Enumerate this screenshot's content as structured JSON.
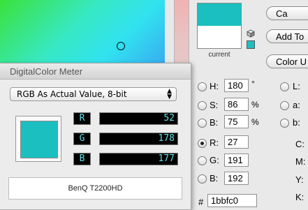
{
  "color_picker": {
    "preview_label": "current",
    "buttons": [
      "Ca",
      "Add To",
      "Color U"
    ],
    "hsb": [
      {
        "label": "H:",
        "value": "180",
        "unit": "°"
      },
      {
        "label": "S:",
        "value": "86",
        "unit": "%"
      },
      {
        "label": "B:",
        "value": "75",
        "unit": "%"
      }
    ],
    "rgb": [
      {
        "label": "R:",
        "value": "27",
        "selected": true
      },
      {
        "label": "G:",
        "value": "191",
        "selected": false
      },
      {
        "label": "B:",
        "value": "192",
        "selected": false
      }
    ],
    "lab": [
      "L:",
      "a:",
      "b:"
    ],
    "cmyk": [
      "C:",
      "M:",
      "Y:",
      "K:"
    ],
    "hex_prefix": "#",
    "hex_value": "1bbfc0",
    "colors": {
      "current": "#1bbfc0"
    }
  },
  "dcm": {
    "title": "DigitalColor Meter",
    "mode": "RGB As Actual Value, 8-bit",
    "channels": [
      {
        "name": "R",
        "value": "52"
      },
      {
        "name": "G",
        "value": "178"
      },
      {
        "name": "B",
        "value": "177"
      }
    ],
    "display": "BenQ T2200HD",
    "swatch_color": "#1bbfc0"
  }
}
